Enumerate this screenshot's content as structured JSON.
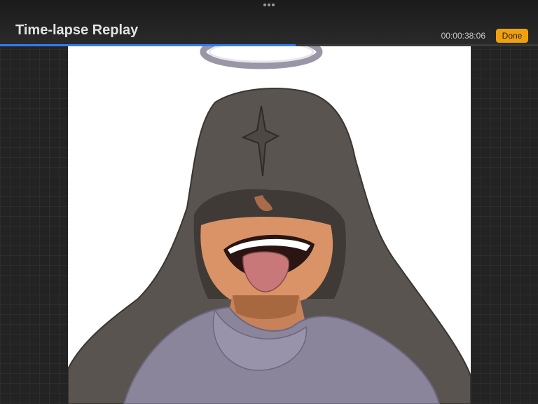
{
  "header": {
    "title": "Time-lapse Replay",
    "elapsed_time": "00:00:38:06",
    "done_label": "Done"
  },
  "playback": {
    "progress": 0.55
  },
  "colors": {
    "accent": "#f0a00f",
    "progress": "#2f7cf6"
  },
  "artwork": {
    "subject": "hooded character illustration"
  }
}
